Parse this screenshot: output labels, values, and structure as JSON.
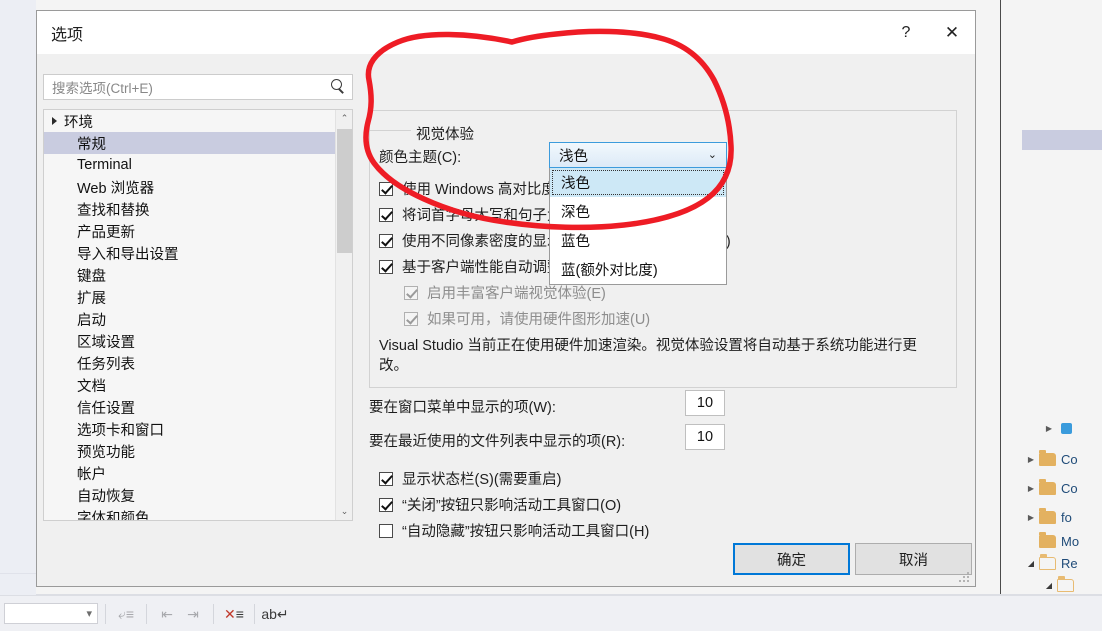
{
  "dialog": {
    "title": "选项",
    "help_icon": "?",
    "close_icon": "✕",
    "search": {
      "placeholder": "搜索选项(Ctrl+E)",
      "icon": "search-icon"
    },
    "tree": {
      "group_label": "环境",
      "items": [
        "常规",
        "Terminal",
        "Web 浏览器",
        "查找和替换",
        "产品更新",
        "导入和导出设置",
        "键盘",
        "扩展",
        "启动",
        "区域设置",
        "任务列表",
        "文档",
        "信任设置",
        "选项卡和窗口",
        "预览功能",
        "帐户",
        "自动恢复",
        "字体和颜色"
      ],
      "selected": "常规",
      "scroll_up_icon": "⌃",
      "scroll_down_icon": "⌄"
    },
    "content": {
      "group_title": "视觉体验",
      "theme_label": "颜色主题(C):",
      "theme_value": "浅色",
      "theme_options": [
        "浅色",
        "深色",
        "蓝色",
        "蓝(额外对比度)"
      ],
      "theme_selected_index": 0,
      "checkboxes": [
        {
          "label": "使用 Windows 高对比度设置(W)",
          "checked": true,
          "enabled": true
        },
        {
          "label": "将词首字母大写和句子大小写应用于菜单栏(A)",
          "checked": true,
          "enabled": true
        },
        {
          "label": "使用不同像素密度的显示器进行优化渲染(需要重启)",
          "checked": true,
          "enabled": true
        },
        {
          "label": "基于客户端性能自动调整视觉体验(A)",
          "checked": true,
          "enabled": true
        }
      ],
      "sub_checkboxes": [
        {
          "label": "启用丰富客户端视觉体验(E)",
          "checked": true,
          "enabled": false
        },
        {
          "label": "如果可用，请使用硬件图形加速(U)",
          "checked": true,
          "enabled": false
        }
      ],
      "note": "Visual Studio 当前正在使用硬件加速渲染。视觉体验设置将自动基于系统功能进行更改。",
      "window_menu_label": "要在窗口菜单中显示的项(W):",
      "window_menu_value": "10",
      "recent_files_label": "要在最近使用的文件列表中显示的项(R):",
      "recent_files_value": "10",
      "bottom_checkboxes": [
        {
          "label": "显示状态栏(S)(需要重启)",
          "checked": true
        },
        {
          "label": "“关闭”按钮只影响活动工具窗口(O)",
          "checked": true
        },
        {
          "label": "“自动隐藏”按钮只影响活动工具窗口(H)",
          "checked": false
        }
      ]
    },
    "footer": {
      "ok_label": "确定",
      "cancel_label": "取消"
    }
  },
  "background": {
    "solution_tree": [
      {
        "name": "Co",
        "expander": "▷",
        "icon": "folder-icon",
        "indent": 0
      },
      {
        "name": "Co",
        "expander": "▷",
        "icon": "folder-icon",
        "indent": 0
      },
      {
        "name": "fo",
        "expander": "▷",
        "icon": "folder-icon",
        "indent": 0
      },
      {
        "name": "Mo",
        "expander": "",
        "icon": "folder-icon",
        "indent": 0
      },
      {
        "name": "Re",
        "expander": "◢",
        "icon": "folder-open-icon",
        "indent": 0
      }
    ],
    "toolbar": {
      "combo_value": "",
      "combo_caret": "▾",
      "icons": [
        "undo-indent-icon",
        "outdent-icon",
        "indent-icon",
        "clear-all-icon",
        "wrap-text-icon"
      ]
    }
  },
  "colors": {
    "accent": "#0078d7",
    "combo_border": "#3c9bdc",
    "selection": "#c9cce0",
    "annotation": "#ee1c25",
    "folder": "#e3b160"
  }
}
